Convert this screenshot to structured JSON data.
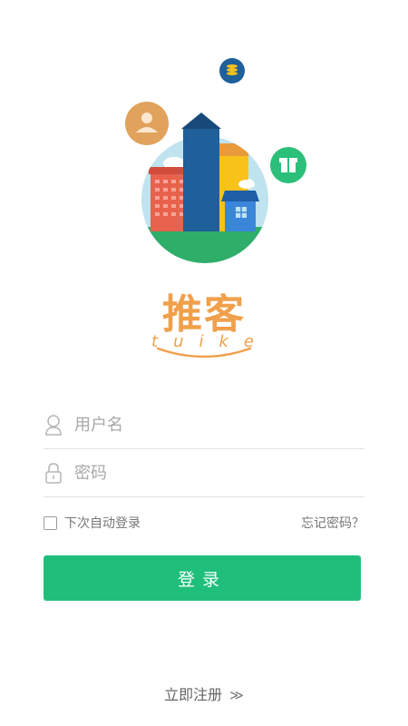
{
  "brand": {
    "name_cn": "推客",
    "name_en": "tuike",
    "color": "#f0a04b"
  },
  "hero": {
    "icons": [
      "coins-icon",
      "user-icon",
      "gift-icon"
    ]
  },
  "form": {
    "username_placeholder": "用户名",
    "password_placeholder": "密码",
    "remember_label": "下次自动登录",
    "remember_checked": false,
    "forgot_label": "忘记密码？",
    "login_label": "登录",
    "login_color": "#1fbf7b"
  },
  "footer": {
    "register_label": "立即注册",
    "register_arrow": "≫"
  }
}
